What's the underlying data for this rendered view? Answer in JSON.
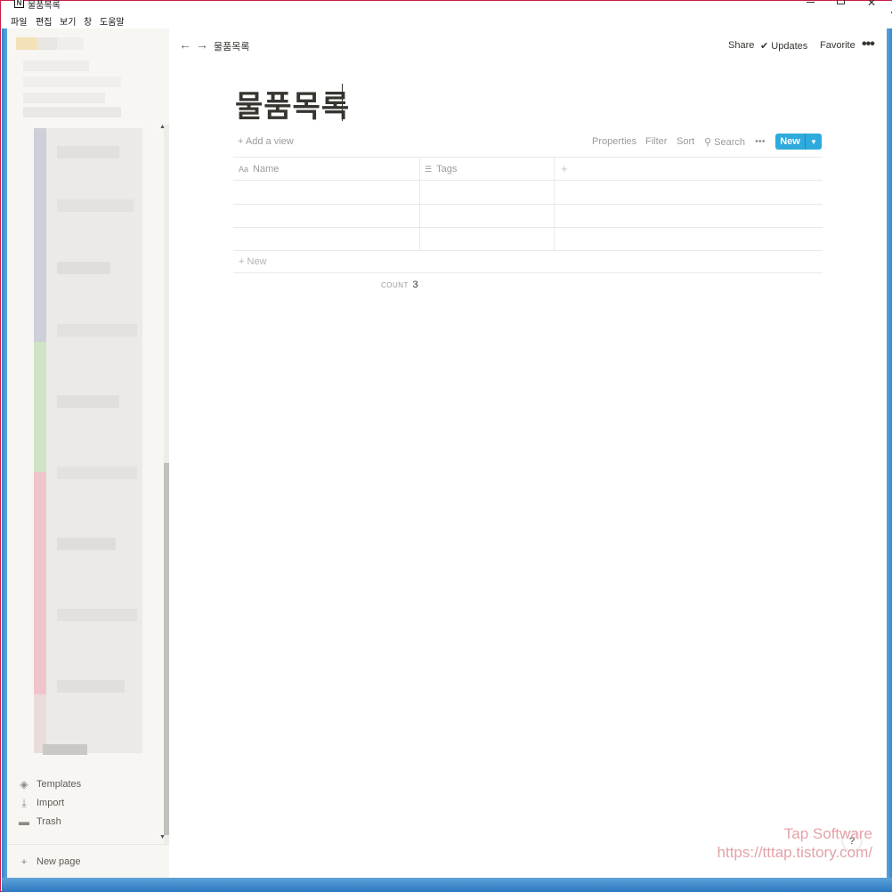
{
  "window": {
    "title": "물품목록",
    "logo_letter": "N",
    "menu": [
      "파일",
      "편집",
      "보기",
      "창",
      "도움말"
    ]
  },
  "sidebar": {
    "items": [
      {
        "label": "Templates",
        "icon": "templates-icon"
      },
      {
        "label": "Import",
        "icon": "import-icon"
      },
      {
        "label": "Trash",
        "icon": "trash-icon"
      }
    ],
    "new_page_label": "New page"
  },
  "topbar": {
    "breadcrumb": "물품목록",
    "share": "Share",
    "updates": "Updates",
    "favorite": "Favorite"
  },
  "page": {
    "title": "물품목록"
  },
  "database": {
    "add_view": "Add a view",
    "tools": [
      "Properties",
      "Filter",
      "Sort",
      "Search"
    ],
    "new_button": "New",
    "columns": [
      {
        "label": "Name",
        "icon": "Aa"
      },
      {
        "label": "Tags",
        "icon": "list-icon"
      }
    ],
    "rows": [
      {
        "name": "",
        "tags": ""
      },
      {
        "name": "",
        "tags": ""
      },
      {
        "name": "",
        "tags": ""
      }
    ],
    "add_row_label": "New",
    "count_label": "COUNT",
    "count_value": "3"
  },
  "help": "?",
  "watermark": {
    "line1": "Tap Software",
    "line2": "https://tttap.tistory.com/"
  },
  "colors": {
    "accent": "#2eaadc",
    "sidebar_bg": "#f7f6f3",
    "text": "#37352f",
    "muted": "#9b9a97",
    "window_border": "#c81e4a"
  }
}
